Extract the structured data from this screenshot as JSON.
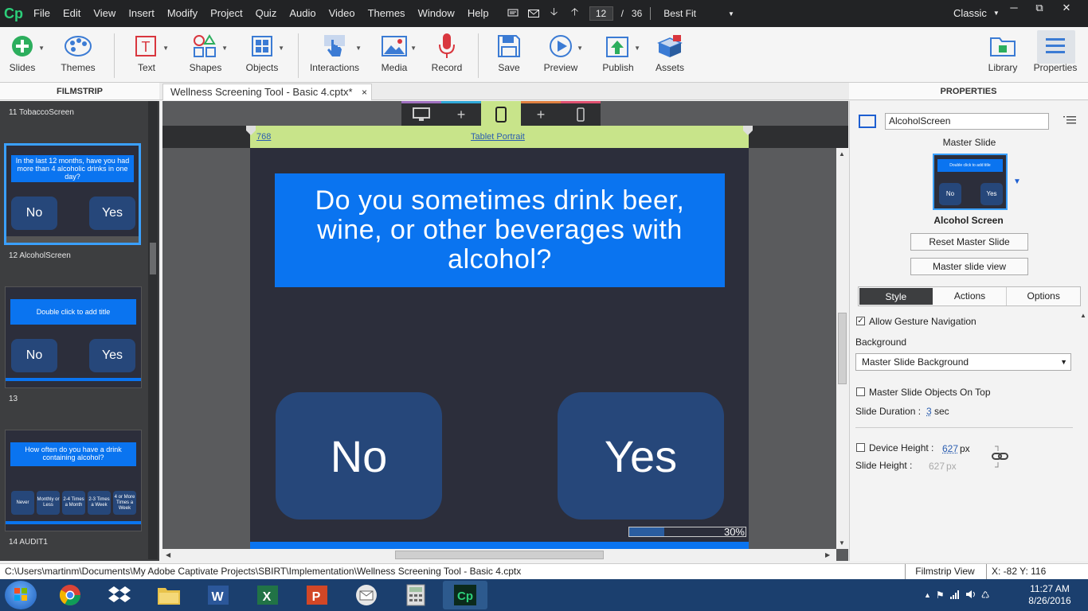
{
  "app": {
    "logo": "Cp"
  },
  "menu": [
    "File",
    "Edit",
    "View",
    "Insert",
    "Modify",
    "Project",
    "Quiz",
    "Audio",
    "Video",
    "Themes",
    "Window",
    "Help"
  ],
  "nav": {
    "current_slide": "12",
    "slide_separator": "/",
    "total_slides": "36",
    "zoom": "Best Fit"
  },
  "workspace": "Classic",
  "toolbar": {
    "items": [
      {
        "label": "Slides",
        "icon": "plus-circle-icon"
      },
      {
        "label": "Themes",
        "icon": "palette-icon"
      },
      {
        "label": "Text",
        "icon": "text-box-icon"
      },
      {
        "label": "Shapes",
        "icon": "shapes-icon"
      },
      {
        "label": "Objects",
        "icon": "objects-grid-icon"
      },
      {
        "label": "Interactions",
        "icon": "hand-pointer-icon"
      },
      {
        "label": "Media",
        "icon": "image-icon"
      },
      {
        "label": "Record",
        "icon": "microphone-icon"
      },
      {
        "label": "Save",
        "icon": "floppy-disk-icon"
      },
      {
        "label": "Preview",
        "icon": "play-circle-icon"
      },
      {
        "label": "Publish",
        "icon": "publish-icon"
      },
      {
        "label": "Assets",
        "icon": "assets-box-icon"
      },
      {
        "label": "Library",
        "icon": "folder-icon"
      },
      {
        "label": "Properties",
        "icon": "properties-lines-icon"
      }
    ]
  },
  "filmstrip": {
    "header": "FILMSTRIP",
    "items": [
      {
        "label": "11 TobaccoScreen"
      },
      {
        "title": "In the last 12 months, have you had more than 4 alcoholic drinks in one day?",
        "buttons": [
          "No",
          "Yes"
        ]
      },
      {
        "label": "12 AlcoholScreen"
      },
      {
        "title": "Double click to add title",
        "buttons": [
          "No",
          "Yes"
        ]
      },
      {
        "label": "13"
      },
      {
        "title": "How often do you have a drink containing alcohol?",
        "options": [
          "Never",
          "Monthly or Less",
          "2-4 Times a Month",
          "2-3 Times a Week",
          "4 or More Times a Week"
        ]
      },
      {
        "label": "14 AUDIT1"
      }
    ]
  },
  "document_tab": {
    "title": "Wellness Screening Tool - Basic 4.cptx*",
    "close": "×"
  },
  "stage": {
    "breakpoint_width": "768",
    "breakpoint_name": "Tablet Portrait",
    "slide": {
      "question": "Do you sometimes drink beer, wine, or other beverages with alcohol?",
      "no_label": "No",
      "yes_label": "Yes",
      "progress_text": "30%",
      "progress_value": 0.3
    }
  },
  "properties": {
    "header": "PROPERTIES",
    "slide_name": "AlcoholScreen",
    "master_slide_label": "Master Slide",
    "master_thumb": {
      "title": "Double click to add title",
      "no": "No",
      "yes": "Yes"
    },
    "master_slide_name": "Alcohol Screen",
    "reset_button": "Reset Master Slide",
    "view_button": "Master slide view",
    "tabs": [
      "Style",
      "Actions",
      "Options"
    ],
    "allow_gesture": "Allow Gesture Navigation",
    "allow_gesture_checked": true,
    "background_label": "Background",
    "background_value": "Master Slide Background",
    "master_objects_on_top": "Master Slide Objects On Top",
    "slide_duration_label": "Slide Duration :",
    "slide_duration_value": "3",
    "slide_duration_unit": "sec",
    "device_height_label": "Device Height :",
    "device_height_value": "627",
    "device_height_unit": "px",
    "slide_height_label": "Slide Height :",
    "slide_height_value": "627",
    "slide_height_unit": "px"
  },
  "status": {
    "path": "C:\\Users\\martinm\\Documents\\My Adobe Captivate Projects\\SBIRT\\Implementation\\Wellness Screening Tool - Basic 4.cptx",
    "view": "Filmstrip View",
    "coords": "X: -82 Y: 116"
  },
  "taskbar": {
    "apps": [
      "chrome-icon",
      "dropbox-icon",
      "file-explorer-icon",
      "word-icon",
      "excel-icon",
      "powerpoint-icon",
      "outlook-icon",
      "calculator-icon",
      "captivate-icon"
    ],
    "time": "11:27 AM",
    "date": "8/26/2016"
  },
  "colors": {
    "accent": "#0a74f0",
    "button": "#26477a",
    "slide_bg": "#2c2e3b",
    "breakpoint": "#c8e48a"
  }
}
